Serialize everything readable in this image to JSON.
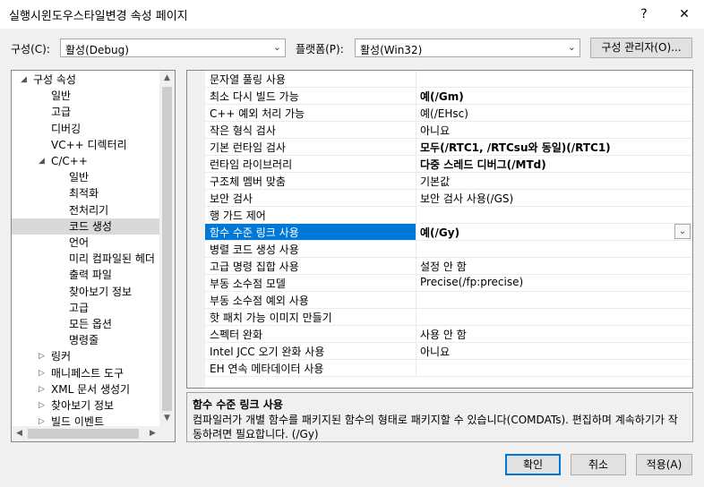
{
  "window": {
    "title": "실행시윈도우스타일변경 속성 페이지",
    "help_glyph": "?",
    "close_glyph": "✕"
  },
  "config_bar": {
    "config_label": "구성(C):",
    "config_value": "활성(Debug)",
    "platform_label": "플랫폼(P):",
    "platform_value": "활성(Win32)",
    "config_manager_label": "구성 관리자(O)..."
  },
  "tree": {
    "nodes": [
      {
        "label": "구성 속성",
        "expander": "◢"
      },
      {
        "label": "일반"
      },
      {
        "label": "고급"
      },
      {
        "label": "디버깅"
      },
      {
        "label": "VC++ 디렉터리"
      },
      {
        "label": "C/C++",
        "expander": "◢"
      },
      {
        "label": "일반"
      },
      {
        "label": "최적화"
      },
      {
        "label": "전처리기"
      },
      {
        "label": "코드 생성",
        "selected": true
      },
      {
        "label": "언어"
      },
      {
        "label": "미리 컴파일된 헤더"
      },
      {
        "label": "출력 파일"
      },
      {
        "label": "찾아보기 정보"
      },
      {
        "label": "고급"
      },
      {
        "label": "모든 옵션"
      },
      {
        "label": "명령줄"
      },
      {
        "label": "링커",
        "expander": "▷"
      },
      {
        "label": "매니페스트 도구",
        "expander": "▷"
      },
      {
        "label": "XML 문서 생성기",
        "expander": "▷"
      },
      {
        "label": "찾아보기 정보",
        "expander": "▷"
      },
      {
        "label": "빌드 이벤트",
        "expander": "▷"
      }
    ]
  },
  "properties": {
    "rows": [
      {
        "name": "문자열 풀링 사용",
        "value": "",
        "bold": false
      },
      {
        "name": "최소 다시 빌드 가능",
        "value": "예(/Gm)",
        "bold": true
      },
      {
        "name": "C++ 예외 처리 가능",
        "value": "예(/EHsc)",
        "bold": false
      },
      {
        "name": "작은 형식 검사",
        "value": "아니요",
        "bold": false
      },
      {
        "name": "기본 런타임 검사",
        "value": "모두(/RTC1, /RTCsu와 동일)(/RTC1)",
        "bold": true
      },
      {
        "name": "런타임 라이브러리",
        "value": "다중 스레드 디버그(/MTd)",
        "bold": true
      },
      {
        "name": "구조체 멤버 맞춤",
        "value": "기본값",
        "bold": false
      },
      {
        "name": "보안 검사",
        "value": "보안 검사 사용(/GS)",
        "bold": false
      },
      {
        "name": "행 가드 제어",
        "value": "",
        "bold": false
      },
      {
        "name": "함수 수준 링크 사용",
        "value": "예(/Gy)",
        "bold": true,
        "selected": true
      },
      {
        "name": "병렬 코드 생성 사용",
        "value": "",
        "bold": false
      },
      {
        "name": "고급 명령 집합 사용",
        "value": "설정 안 함",
        "bold": false
      },
      {
        "name": "부동 소수점 모델",
        "value": "Precise(/fp:precise)",
        "bold": false
      },
      {
        "name": "부동 소수점 예외 사용",
        "value": "",
        "bold": false
      },
      {
        "name": "핫 패치 가능 이미지 만들기",
        "value": "",
        "bold": false
      },
      {
        "name": "스펙터 완화",
        "value": "사용 안 함",
        "bold": false
      },
      {
        "name": "Intel JCC 오기 완화 사용",
        "value": "아니요",
        "bold": false
      },
      {
        "name": "EH 연속 메타데이터 사용",
        "value": "",
        "bold": false
      }
    ]
  },
  "description": {
    "title": "함수 수준 링크 사용",
    "body": "컴파일러가 개별 함수를 패키지된 함수의 형태로 패키지할 수 있습니다(COMDATs). 편집하며 계속하기가 작동하려면 필요합니다.     (/Gy)"
  },
  "buttons": {
    "ok": "확인",
    "cancel": "취소",
    "apply": "적용(A)"
  },
  "icons": {
    "combo_arrow": "⌄",
    "up_arrow": "▲",
    "down_arrow": "▼",
    "left_arrow": "◀",
    "right_arrow": "▶",
    "dropdown_arrow": "⌄"
  }
}
